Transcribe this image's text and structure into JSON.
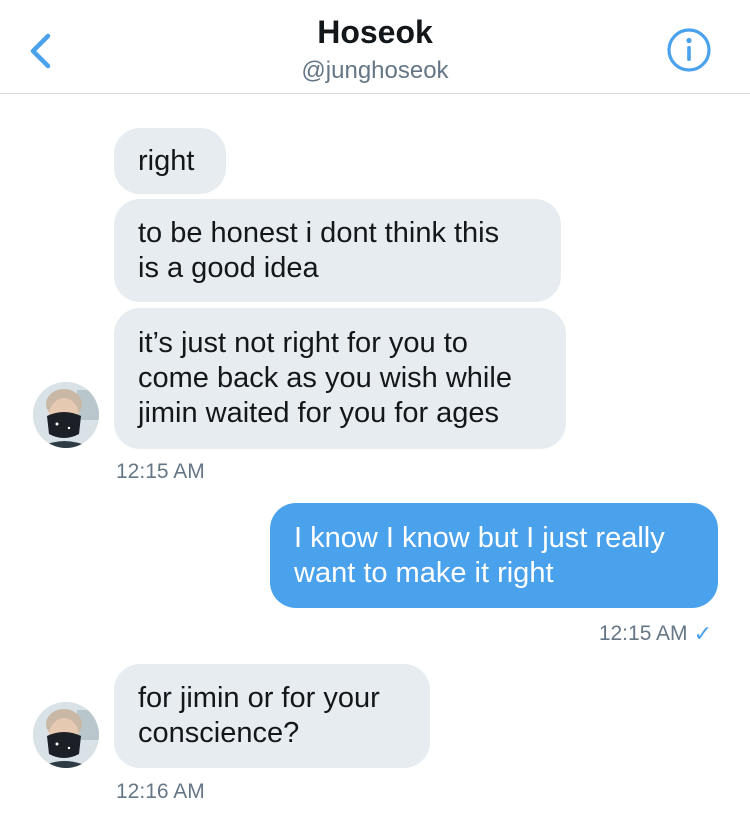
{
  "header": {
    "name": "Hoseok",
    "handle": "@junghoseok",
    "back_icon": "chevron-left-icon",
    "info_icon": "info-icon",
    "accent": "#4aa1ec"
  },
  "messages": [
    {
      "from": "them",
      "lines": [
        "right"
      ]
    },
    {
      "from": "them",
      "lines": [
        "to be honest i dont think this",
        "is a good idea"
      ]
    },
    {
      "from": "them",
      "lines": [
        "it’s just not right for you to",
        "come back as you wish while",
        "jimin waited for you for ages"
      ]
    },
    {
      "time": "12:15 AM"
    },
    {
      "from": "me",
      "lines": [
        "I know I know but I just really",
        "want to make it right"
      ]
    },
    {
      "time": "12:15 AM",
      "read_mark": "✓"
    },
    {
      "from": "them",
      "lines": [
        "for jimin or for your",
        "conscience?"
      ]
    },
    {
      "time": "12:16 AM"
    }
  ]
}
